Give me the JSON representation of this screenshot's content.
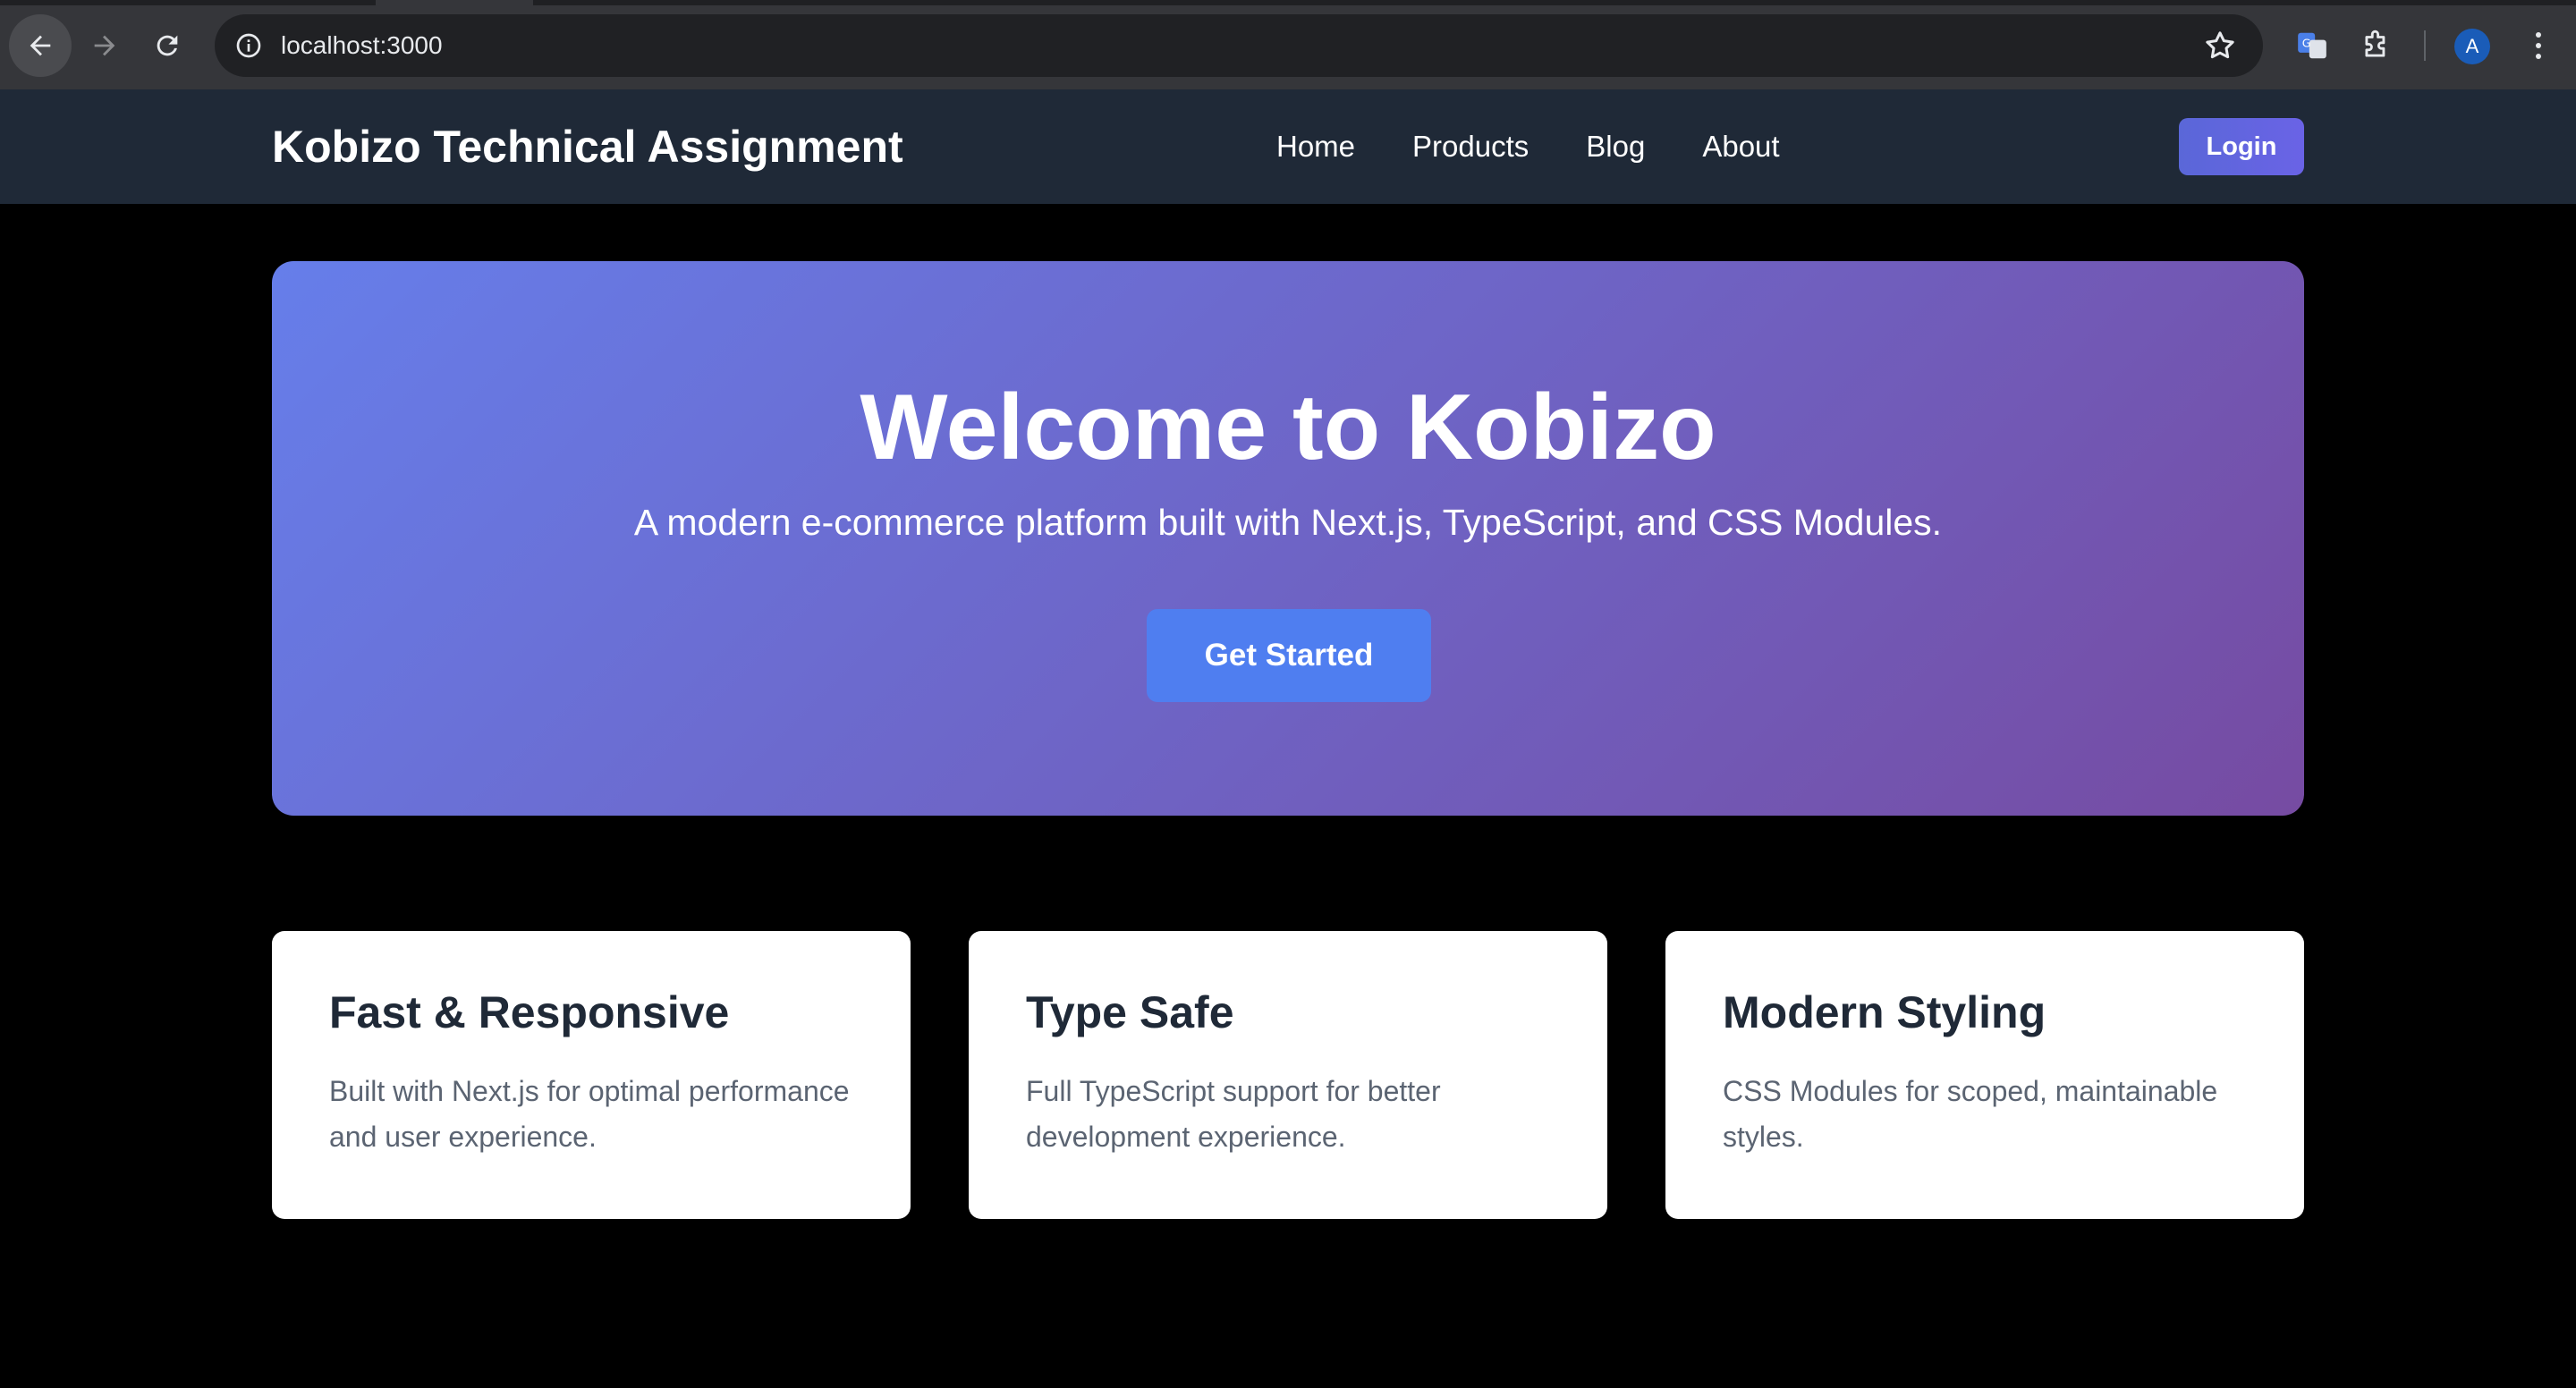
{
  "browser": {
    "url": "localhost:3000",
    "profile_initial": "A",
    "icons": [
      "back-arrow-icon",
      "forward-arrow-icon",
      "reload-icon",
      "site-info-icon",
      "bookmark-star-icon",
      "translate-icon",
      "extensions-puzzle-icon",
      "more-menu-icon"
    ]
  },
  "header": {
    "brand": "Kobizo Technical Assignment",
    "nav": [
      "Home",
      "Products",
      "Blog",
      "About"
    ],
    "login_label": "Login"
  },
  "hero": {
    "title": "Welcome to Kobizo",
    "subtitle": "A modern e-commerce platform built with Next.js, TypeScript, and CSS Modules.",
    "cta_label": "Get Started"
  },
  "features": [
    {
      "title": "Fast & Responsive",
      "description": "Built with Next.js for optimal performance and user experience."
    },
    {
      "title": "Type Safe",
      "description": "Full TypeScript support for better development experience."
    },
    {
      "title": "Modern Styling",
      "description": "CSS Modules for scoped, maintainable styles."
    }
  ],
  "colors": {
    "header_bg": "#1f2937",
    "hero_gradient_start": "#667eea",
    "hero_gradient_end": "#764ba2",
    "cta_bg": "#4f7ef0",
    "login_bg": "#5a67d8",
    "page_bg": "#000000"
  }
}
